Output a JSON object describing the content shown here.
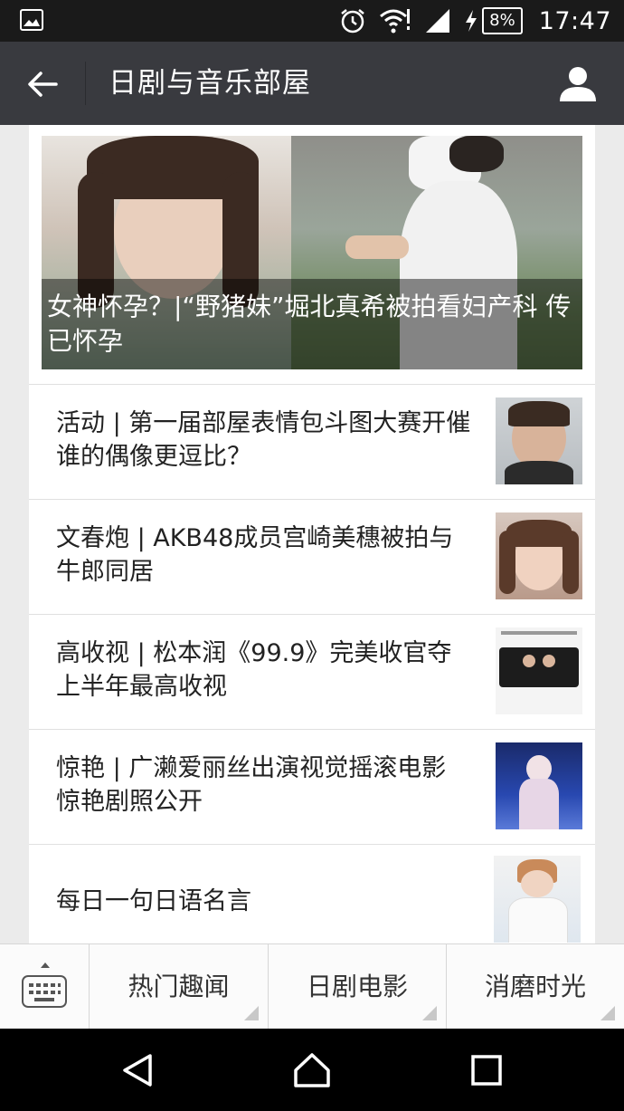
{
  "status": {
    "battery": "8%",
    "time": "17:47"
  },
  "header": {
    "title": "日剧与音乐部屋"
  },
  "cover": {
    "headline": "女神怀孕？|“野猪妹”堀北真希被拍看妇产科 传已怀孕"
  },
  "articles": [
    {
      "headline": "活动 | 第一届部屋表情包斗图大赛开催 谁的偶像更逗比？"
    },
    {
      "headline": "文春炮 | AKB48成员宫崎美穗被拍与牛郎同居"
    },
    {
      "headline": "高收视 | 松本润《99.9》完美收官夺上半年最高收视"
    },
    {
      "headline": "惊艳 | 广濑爱丽丝出演视觉摇滚电影 惊艳剧照公开"
    },
    {
      "headline": "每日一句日语名言"
    }
  ],
  "menu": {
    "items": [
      {
        "label": "热门趣闻"
      },
      {
        "label": "日剧电影"
      },
      {
        "label": "消磨时光"
      }
    ]
  },
  "colors": {
    "status_bar": "#1a1a1a",
    "title_bar": "#393a3f",
    "background": "#ebebeb"
  },
  "icons": [
    "image-icon",
    "alarm-icon",
    "wifi-icon",
    "signal-icon",
    "battery-icon",
    "back-arrow-icon",
    "profile-icon",
    "keyboard-icon",
    "back-nav-icon",
    "home-nav-icon",
    "recents-nav-icon"
  ]
}
